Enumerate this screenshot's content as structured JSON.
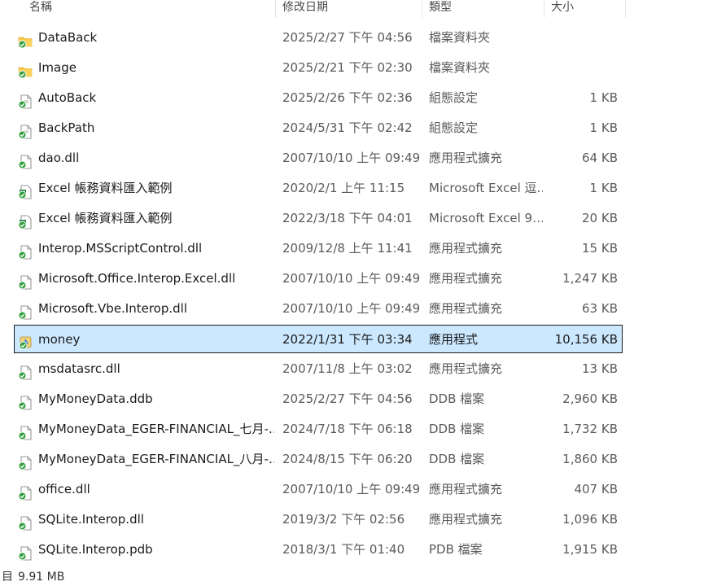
{
  "columns": {
    "name": "名稱",
    "date": "修改日期",
    "type": "類型",
    "size": "大小"
  },
  "files": [
    {
      "name": "DataBack",
      "date": "2025/2/27 下午 04:56",
      "type": "檔案資料夾",
      "size": "",
      "icon": "folder-icon"
    },
    {
      "name": "Image",
      "date": "2025/2/21 下午 02:30",
      "type": "檔案資料夾",
      "size": "",
      "icon": "folder-icon"
    },
    {
      "name": "AutoBack",
      "date": "2025/2/26 下午 02:36",
      "type": "組態設定",
      "size": "1 KB",
      "icon": "config-file-icon"
    },
    {
      "name": "BackPath",
      "date": "2024/5/31 下午 02:42",
      "type": "組態設定",
      "size": "1 KB",
      "icon": "config-file-icon"
    },
    {
      "name": "dao.dll",
      "date": "2007/10/10 上午 09:49",
      "type": "應用程式擴充",
      "size": "64 KB",
      "icon": "dll-file-icon"
    },
    {
      "name": "Excel 帳務資料匯入範例",
      "date": "2020/2/1 上午 11:15",
      "type": "Microsoft Excel 逗…",
      "size": "1 KB",
      "icon": "excel-file-icon"
    },
    {
      "name": "Excel 帳務資料匯入範例",
      "date": "2022/3/18 下午 04:01",
      "type": "Microsoft Excel 9…",
      "size": "20 KB",
      "icon": "excel-file-icon"
    },
    {
      "name": "Interop.MSScriptControl.dll",
      "date": "2009/12/8 上午 11:41",
      "type": "應用程式擴充",
      "size": "15 KB",
      "icon": "dll-file-icon"
    },
    {
      "name": "Microsoft.Office.Interop.Excel.dll",
      "date": "2007/10/10 上午 09:49",
      "type": "應用程式擴充",
      "size": "1,247 KB",
      "icon": "dll-file-icon"
    },
    {
      "name": "Microsoft.Vbe.Interop.dll",
      "date": "2007/10/10 上午 09:49",
      "type": "應用程式擴充",
      "size": "63 KB",
      "icon": "dll-file-icon"
    },
    {
      "name": "money",
      "date": "2022/1/31 下午 03:34",
      "type": "應用程式",
      "size": "10,156 KB",
      "icon": "application-icon",
      "selected": true
    },
    {
      "name": "msdatasrc.dll",
      "date": "2007/11/8 上午 03:02",
      "type": "應用程式擴充",
      "size": "13 KB",
      "icon": "dll-file-icon"
    },
    {
      "name": "MyMoneyData.ddb",
      "date": "2025/2/27 下午 04:56",
      "type": "DDB 檔案",
      "size": "2,960 KB",
      "icon": "generic-file-icon"
    },
    {
      "name": "MyMoneyData_EGER-FINANCIAL_七月-…",
      "date": "2024/7/18 下午 06:18",
      "type": "DDB 檔案",
      "size": "1,732 KB",
      "icon": "generic-file-icon"
    },
    {
      "name": "MyMoneyData_EGER-FINANCIAL_八月-…",
      "date": "2024/8/15 下午 06:20",
      "type": "DDB 檔案",
      "size": "1,860 KB",
      "icon": "generic-file-icon"
    },
    {
      "name": "office.dll",
      "date": "2007/10/10 上午 09:49",
      "type": "應用程式擴充",
      "size": "407 KB",
      "icon": "dll-file-icon"
    },
    {
      "name": "SQLite.Interop.dll",
      "date": "2019/3/2 下午 02:56",
      "type": "應用程式擴充",
      "size": "1,096 KB",
      "icon": "dll-file-icon"
    },
    {
      "name": "SQLite.Interop.pdb",
      "date": "2018/3/1 下午 01:40",
      "type": "PDB 檔案",
      "size": "1,915 KB",
      "icon": "generic-file-icon"
    }
  ],
  "status": {
    "glyph": "目",
    "selected_size": "9.91 MB"
  },
  "colors": {
    "selection_bg": "#cce8ff",
    "sync_badge": "#2e9d3a",
    "folder": "#f4c542"
  }
}
